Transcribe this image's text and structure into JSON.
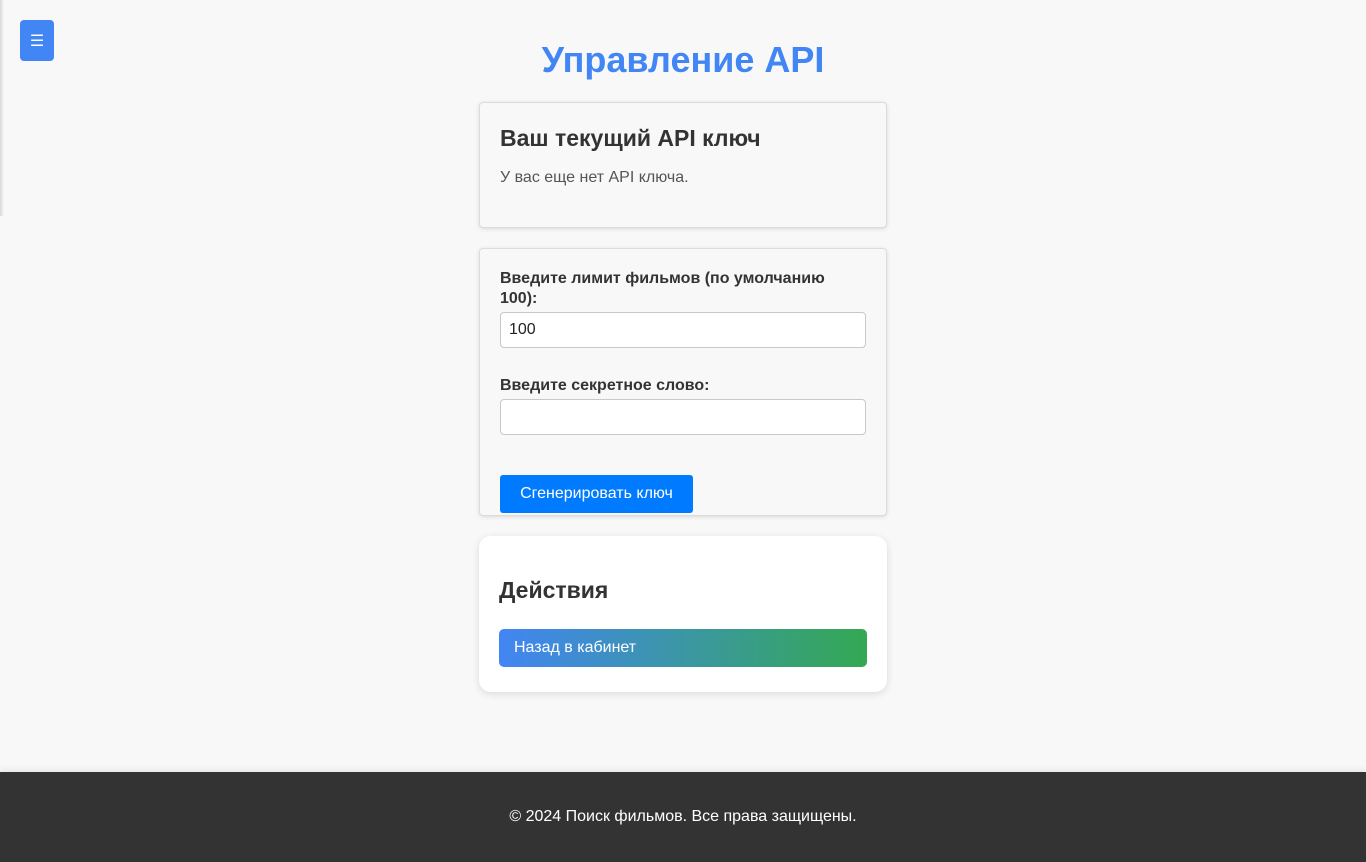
{
  "header": {
    "menu_icon": "hamburger-icon",
    "menu_glyph": "☰",
    "title": "Управление API"
  },
  "current_key": {
    "heading": "Ваш текущий API ключ",
    "message": "У вас еще нет API ключа."
  },
  "form": {
    "limit_label": "Введите лимит фильмов (по умолчанию 100):",
    "limit_value": "100",
    "secret_label": "Введите секретное слово:",
    "secret_value": "",
    "generate_label": "Сгенерировать ключ"
  },
  "actions": {
    "heading": "Действия",
    "back_label": "Назад в кабинет"
  },
  "footer": {
    "text": "© 2024 Поиск фильмов. Все права защищены."
  },
  "colors": {
    "accent": "#4285f4",
    "button": "#007bff",
    "gradient_end": "#34a853",
    "footer_bg": "#333333"
  }
}
